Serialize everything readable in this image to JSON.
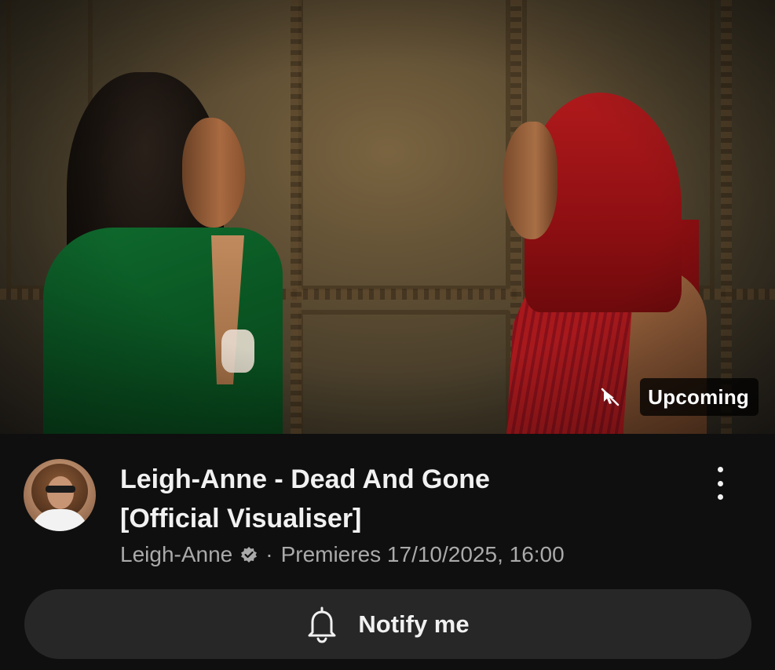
{
  "thumbnail": {
    "badge_label": "Upcoming",
    "badge_icon": "cursor-slash-icon"
  },
  "video": {
    "title_line1": "Leigh-Anne - Dead And Gone",
    "title_line2": "[Official Visualiser]",
    "channel": "Leigh-Anne",
    "separator": "·",
    "premiere": "Premieres 17/10/2025, 16:00",
    "more_icon": "more-vertical-icon"
  },
  "actions": {
    "notify_label": "Notify me",
    "notify_icon": "bell-icon"
  },
  "colors": {
    "background": "#0f0f0f",
    "button_bg": "#272727",
    "text_primary": "#f1f1f1",
    "text_secondary": "#aaaaaa"
  }
}
